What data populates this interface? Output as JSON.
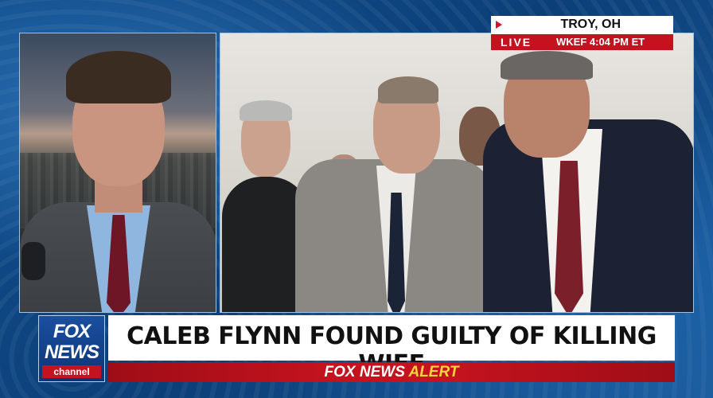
{
  "location": {
    "city": "TROY, OH",
    "live_label": "LIVE",
    "station_time": "WKEF  4:04 PM ET"
  },
  "logo": {
    "line1": "FOX",
    "line2": "NEWS",
    "line3": "channel"
  },
  "lower_third": {
    "headline": "CALEB FLYNN FOUND GUILTY OF KILLING WIFE",
    "alert_brand": "FOX NEWS",
    "alert_word": "ALERT"
  },
  "colors": {
    "fox_red": "#c4131f",
    "fox_blue": "#0d3475",
    "alert_yellow": "#ffd43b"
  }
}
